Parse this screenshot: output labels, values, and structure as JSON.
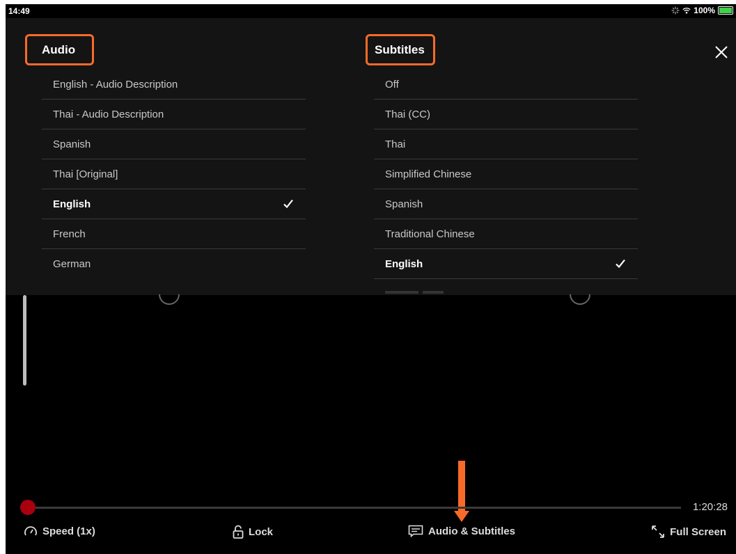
{
  "status_bar": {
    "time": "14:49",
    "battery": "100%"
  },
  "audio": {
    "header": "Audio",
    "items": [
      {
        "label": "English - Audio Description",
        "selected": false
      },
      {
        "label": "Thai - Audio Description",
        "selected": false
      },
      {
        "label": "Spanish",
        "selected": false
      },
      {
        "label": "Thai [Original]",
        "selected": false
      },
      {
        "label": "English",
        "selected": true
      },
      {
        "label": "French",
        "selected": false
      },
      {
        "label": "German",
        "selected": false
      }
    ]
  },
  "subtitles": {
    "header": "Subtitles",
    "items": [
      {
        "label": "Off",
        "selected": false
      },
      {
        "label": "Thai (CC)",
        "selected": false
      },
      {
        "label": "Thai",
        "selected": false
      },
      {
        "label": "Simplified Chinese",
        "selected": false
      },
      {
        "label": "Spanish",
        "selected": false
      },
      {
        "label": "Traditional Chinese",
        "selected": false
      },
      {
        "label": "English",
        "selected": true
      }
    ]
  },
  "player": {
    "progress": 0.0,
    "time_remaining": "1:20:28",
    "controls": {
      "speed": "Speed (1x)",
      "lock": "Lock",
      "audio_subtitles": "Audio & Subtitles",
      "full_screen": "Full Screen"
    }
  },
  "colors": {
    "highlight": "#f86a2a",
    "progress_knob": "#a8000f",
    "background": "#000000",
    "panel": "#141414"
  }
}
